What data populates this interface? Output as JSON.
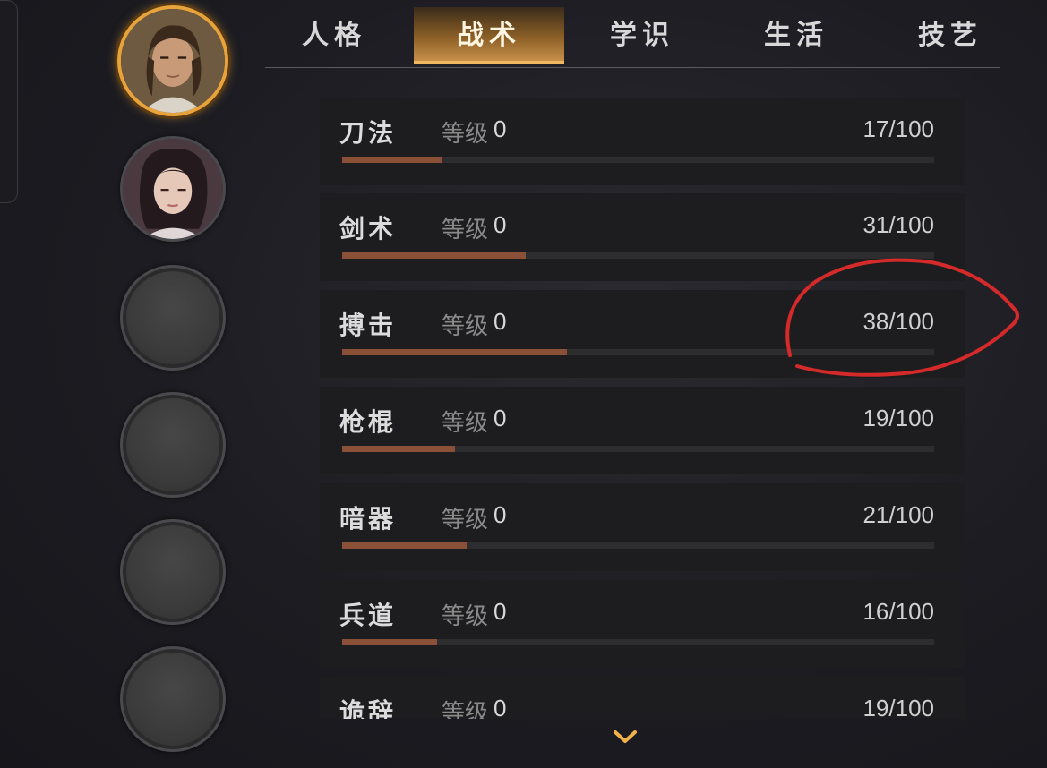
{
  "tabs": [
    {
      "label": "人格",
      "selected": false
    },
    {
      "label": "战术",
      "selected": true
    },
    {
      "label": "学识",
      "selected": false
    },
    {
      "label": "生活",
      "selected": false
    },
    {
      "label": "技艺",
      "selected": false
    }
  ],
  "skills": [
    {
      "name": "刀法",
      "level_label": "等级",
      "level": "0",
      "progress_text": "17/100",
      "progress": 0.17
    },
    {
      "name": "剑术",
      "level_label": "等级",
      "level": "0",
      "progress_text": "31/100",
      "progress": 0.31
    },
    {
      "name": "搏击",
      "level_label": "等级",
      "level": "0",
      "progress_text": "38/100",
      "progress": 0.38
    },
    {
      "name": "枪棍",
      "level_label": "等级",
      "level": "0",
      "progress_text": "19/100",
      "progress": 0.19
    },
    {
      "name": "暗器",
      "level_label": "等级",
      "level": "0",
      "progress_text": "21/100",
      "progress": 0.21
    },
    {
      "name": "兵道",
      "level_label": "等级",
      "level": "0",
      "progress_text": "16/100",
      "progress": 0.16
    },
    {
      "name": "诡辞",
      "level_label": "等级",
      "level": "0",
      "progress_text": "19/100",
      "progress": 0.19
    }
  ],
  "characters": [
    {
      "type": "male-portrait",
      "selected": true
    },
    {
      "type": "female-portrait",
      "selected": false
    },
    {
      "type": "empty-slot",
      "selected": false
    },
    {
      "type": "empty-slot",
      "selected": false
    },
    {
      "type": "empty-slot",
      "selected": false
    },
    {
      "type": "empty-slot",
      "selected": false
    }
  ],
  "colors": {
    "accent": "#e8a43a",
    "progress_fill": "#8a5038",
    "annotation": "#d42a2a"
  },
  "icons": {
    "scroll_down": "chevron-down-icon"
  }
}
